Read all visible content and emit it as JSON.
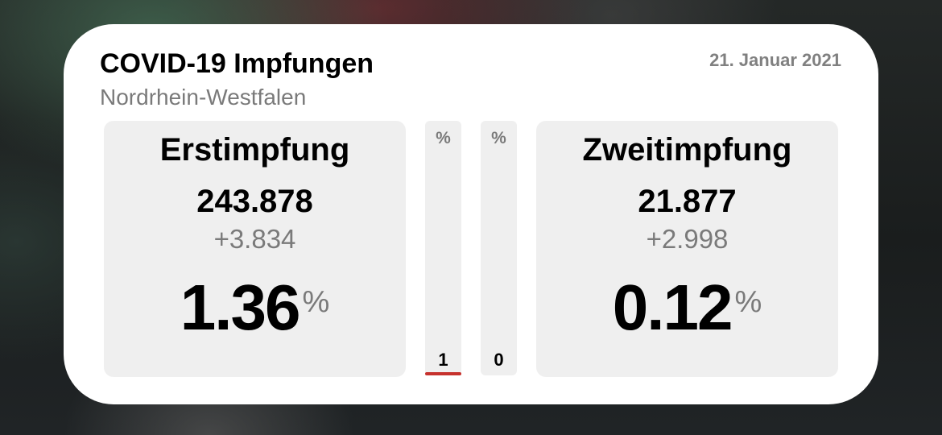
{
  "widget": {
    "title": "COVID-19 Impfungen",
    "subtitle": "Nordrhein-Westfalen",
    "date": "21. Januar 2021"
  },
  "first_dose": {
    "label": "Erstimpfung",
    "count": "243.878",
    "delta": "+3.834",
    "percent": "1.36",
    "percent_sign": "%"
  },
  "second_dose": {
    "label": "Zweitimpfung",
    "count": "21.877",
    "delta": "+2.998",
    "percent": "0.12",
    "percent_sign": "%"
  },
  "bars": [
    {
      "header": "%",
      "label": "1",
      "fill_percent": 1.36
    },
    {
      "header": "%",
      "label": "0",
      "fill_percent": 0.12
    }
  ],
  "colors": {
    "bar_fill": "#c6322d",
    "panel_background": "#efefef",
    "secondary_text": "#7a7a7a"
  }
}
